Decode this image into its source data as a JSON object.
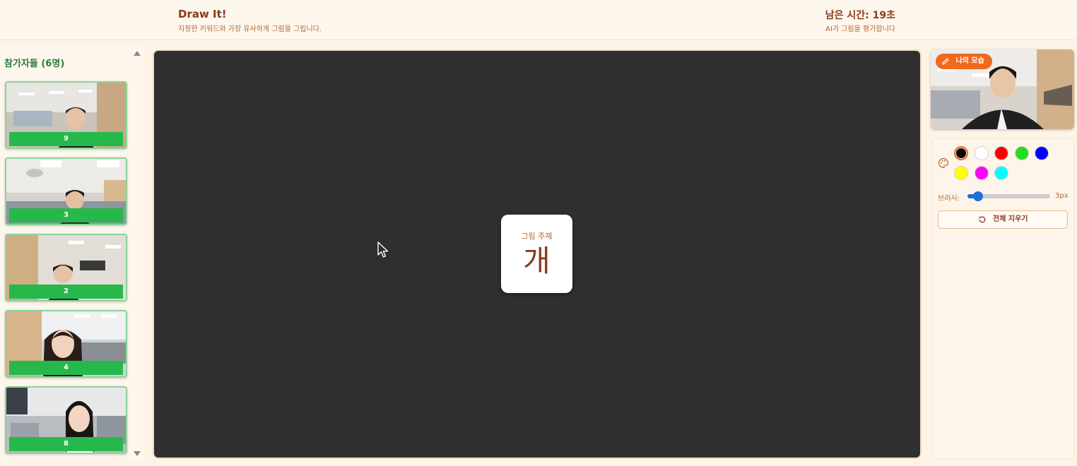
{
  "header": {
    "title": "Draw It!",
    "subtitle": "지정한 키워드와 가장 유사하게 그림을 그립니다.",
    "timer": "남은 시간: 19초",
    "ai_note": "AI가 그림을 평가합니다"
  },
  "participants": {
    "title": "참가자들 (6명)",
    "tiles": [
      {
        "label": "9"
      },
      {
        "label": "3"
      },
      {
        "label": "2"
      },
      {
        "label": "4"
      },
      {
        "label": "8"
      }
    ]
  },
  "canvas": {
    "topic_label": "그림 주제",
    "topic_word": "개"
  },
  "self_view": {
    "badge_label": "나의 모습"
  },
  "tools": {
    "colors": [
      "#000000",
      "#ffffff",
      "#ff0000",
      "#22dd22",
      "#0000ff",
      "#ffff00",
      "#ff00ff",
      "#00ffff"
    ],
    "selected_color": "#000000",
    "brush_label": "브러시:",
    "brush_size_label": "3px",
    "brush_level": 0.1,
    "clear_label": "전체 지우기"
  }
}
